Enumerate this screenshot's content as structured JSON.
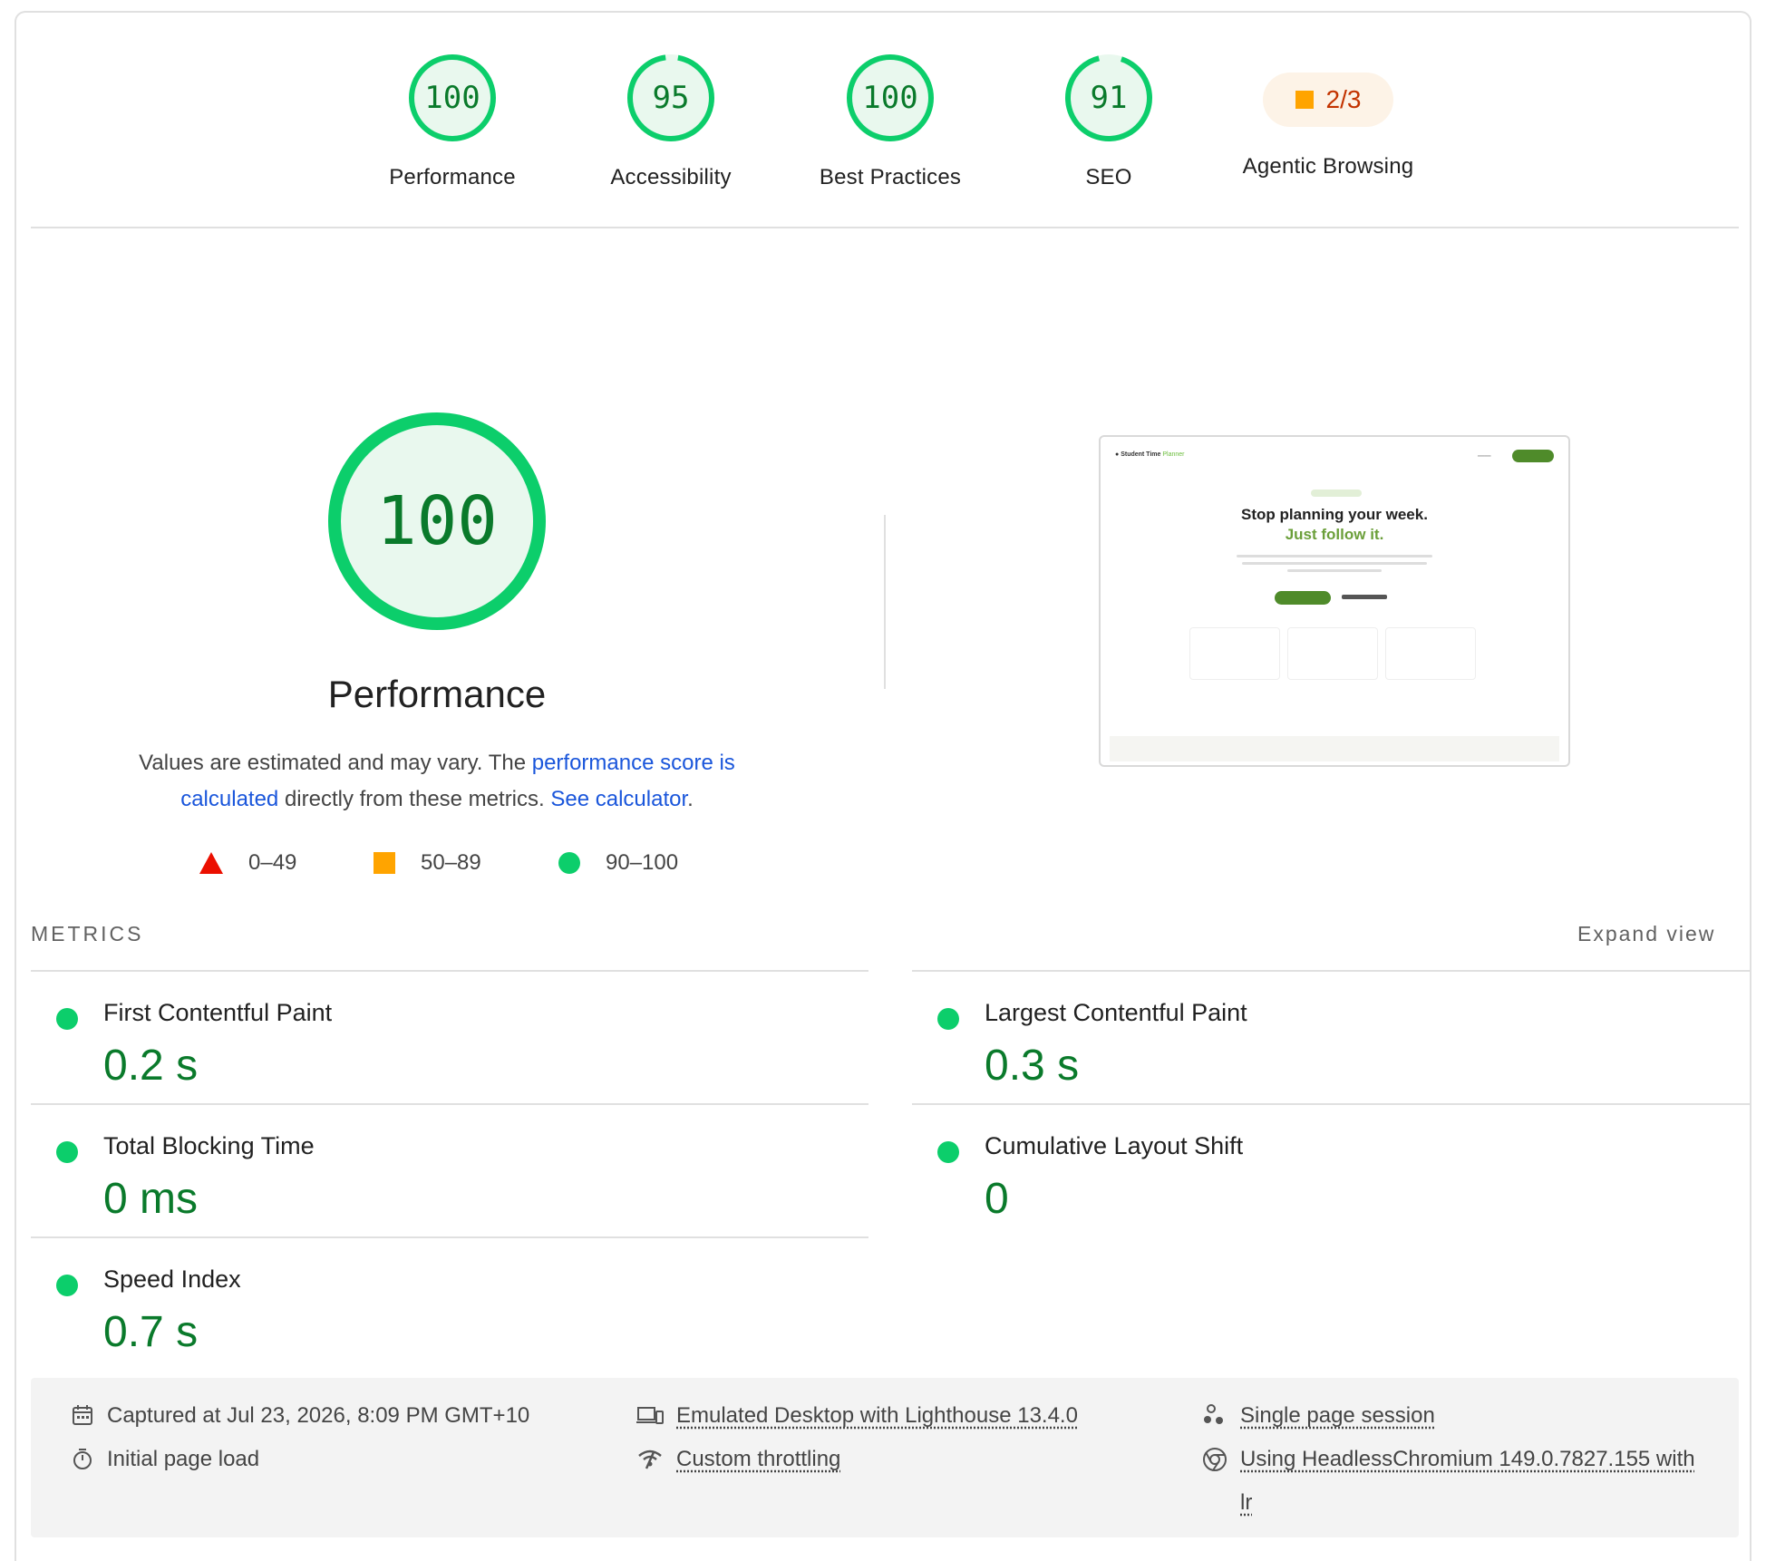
{
  "categories": [
    {
      "score": "100",
      "value": 100,
      "label": "Performance"
    },
    {
      "score": "95",
      "value": 95,
      "label": "Accessibility"
    },
    {
      "score": "100",
      "value": 100,
      "label": "Best Practices"
    },
    {
      "score": "91",
      "value": 91,
      "label": "SEO"
    }
  ],
  "agentic": {
    "score": "2/3",
    "label": "Agentic Browsing"
  },
  "performance": {
    "score": "100",
    "title": "Performance",
    "desc_pre": "Values are estimated and may vary. The ",
    "desc_link1": "performance score is calculated",
    "desc_mid": " directly from these metrics. ",
    "desc_link2": "See calculator",
    "desc_end": "."
  },
  "legend": {
    "fail": "0–49",
    "average": "50–89",
    "pass": "90–100"
  },
  "colors": {
    "pass": "#0cce6b",
    "pass_text": "#0a7a2b",
    "average": "#ffa400",
    "fail": "#eb0f00",
    "link": "#1a56db"
  },
  "thumbnail": {
    "brand": "Student Time",
    "brand_accent": "Planner",
    "headline": "Stop planning your week.",
    "subheadline": "Just follow it."
  },
  "metrics": {
    "title": "METRICS",
    "expand": "Expand view",
    "items": [
      {
        "name": "First Contentful Paint",
        "value": "0.2 s"
      },
      {
        "name": "Largest Contentful Paint",
        "value": "0.3 s"
      },
      {
        "name": "Total Blocking Time",
        "value": "0 ms"
      },
      {
        "name": "Cumulative Layout Shift",
        "value": "0"
      },
      {
        "name": "Speed Index",
        "value": "0.7 s"
      }
    ]
  },
  "footer": {
    "captured": "Captured at Jul 23, 2026, 8:09 PM GMT+10",
    "load": "Initial page load",
    "emulated": "Emulated Desktop with Lighthouse 13.4.0",
    "throttling": "Custom throttling",
    "session": "Single page session",
    "browser_line1": "Using HeadlessChromium 149.0.7827.155 with",
    "browser_line2": "lr"
  }
}
